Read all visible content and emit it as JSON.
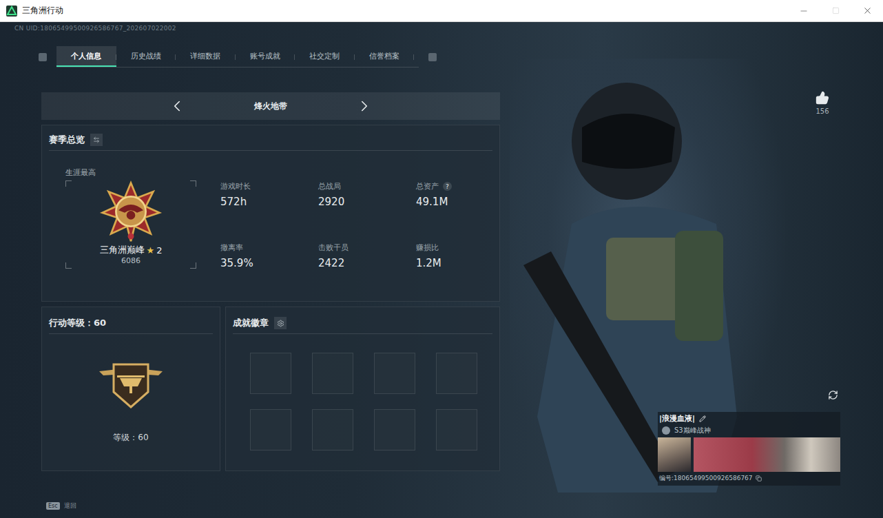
{
  "window": {
    "title": "三角洲行动"
  },
  "uid": "CN UID:18065499500926586767_202607022002",
  "tabs": [
    {
      "label": "个人信息",
      "selected": true
    },
    {
      "label": "历史战绩",
      "selected": false
    },
    {
      "label": "详细数据",
      "selected": false
    },
    {
      "label": "账号成就",
      "selected": false
    },
    {
      "label": "社交定制",
      "selected": false
    },
    {
      "label": "信誉档案",
      "selected": false
    }
  ],
  "mode_selector": {
    "label": "烽火地带"
  },
  "season": {
    "title": "赛季总览",
    "career_label": "生涯最高",
    "rank": "三角洲巅峰",
    "rank_stars": "2",
    "rank_score": "6086",
    "stats": [
      {
        "label": "游戏时长",
        "value": "572h",
        "hint": null
      },
      {
        "label": "总战局",
        "value": "2920",
        "hint": null
      },
      {
        "label": "总资产",
        "value": "49.1M",
        "hint": "?"
      },
      {
        "label": "撤离率",
        "value": "35.9%",
        "hint": null
      },
      {
        "label": "击败干员",
        "value": "2422",
        "hint": null
      },
      {
        "label": "赚损比",
        "value": "1.2M",
        "hint": null
      }
    ]
  },
  "level": {
    "title": "行动等级：60",
    "caption": "等级：60"
  },
  "achievements": {
    "title": "成就徽章",
    "slots": [
      {
        "filled": false
      },
      {
        "filled": false
      },
      {
        "filled": false
      },
      {
        "filled": false
      },
      {
        "filled": false
      },
      {
        "filled": false
      },
      {
        "filled": false
      },
      {
        "filled": false
      }
    ]
  },
  "likes": {
    "count": "156"
  },
  "card": {
    "name": "|浪漫血液|",
    "title": "S3巅峰战神",
    "id": "编号:18065499500926586767"
  },
  "footer": {
    "key": "Esc",
    "label": "退回"
  }
}
